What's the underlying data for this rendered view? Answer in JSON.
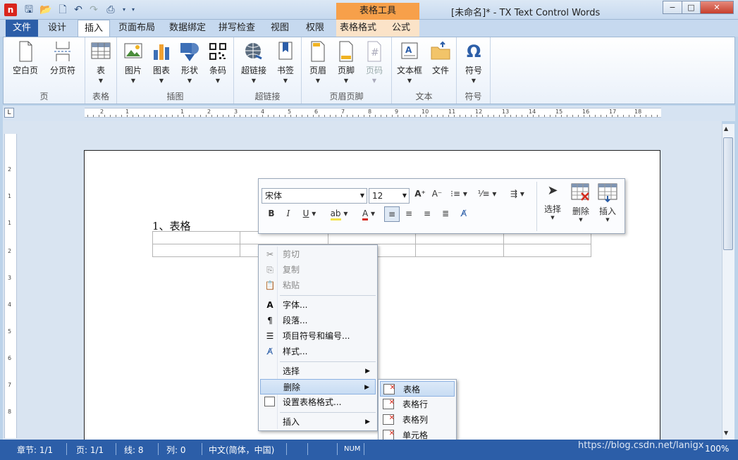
{
  "title_bar": {
    "window_title": "[未命名]* - TX Text Control Words",
    "context_tab_header": "表格工具",
    "minimize": "−",
    "maximize": "□",
    "close": "✕"
  },
  "tabs": [
    "文件",
    "设计",
    "插入",
    "页面布局",
    "数据绑定",
    "拼写检查",
    "视图",
    "权限",
    "表格格式",
    "公式"
  ],
  "ribbon": {
    "groups": {
      "page": {
        "label": "页",
        "buttons": [
          "空白页",
          "分页符"
        ]
      },
      "table": {
        "label": "表格",
        "buttons": [
          "表"
        ]
      },
      "illustrations": {
        "label": "插图",
        "buttons": [
          "图片",
          "图表",
          "形状",
          "条码"
        ]
      },
      "hyperlink": {
        "label": "超链接",
        "buttons": [
          "超链接",
          "书签"
        ]
      },
      "header_footer": {
        "label": "页眉页脚",
        "buttons": [
          "页眉",
          "页脚",
          "页码"
        ]
      },
      "text": {
        "label": "文本",
        "buttons": [
          "文本框",
          "文件"
        ]
      },
      "symbol": {
        "label": "符号",
        "buttons": [
          "符号"
        ]
      }
    }
  },
  "ruler": {
    "h_numbers": [
      "2",
      "1",
      "1",
      "2",
      "3",
      "4",
      "5",
      "6",
      "7",
      "8",
      "9",
      "10",
      "11",
      "12",
      "13",
      "14",
      "15",
      "16",
      "17",
      "18"
    ],
    "v_numbers": [
      "2",
      "1",
      "1",
      "2",
      "3",
      "4",
      "5",
      "6",
      "7",
      "8"
    ]
  },
  "document": {
    "heading": "1、表格",
    "table_rows": 2,
    "table_cols": 5
  },
  "mini_toolbar": {
    "font_name": "宋体",
    "font_size": "12",
    "buttons": {
      "select": "选择",
      "delete": "删除",
      "insert": "插入"
    }
  },
  "context_menu": {
    "items": [
      "剪切",
      "复制",
      "粘贴",
      "字体...",
      "段落...",
      "项目符号和编号...",
      "样式...",
      "选择",
      "删除",
      "设置表格格式...",
      "插入"
    ]
  },
  "submenu_delete": {
    "items": [
      "表格",
      "表格行",
      "表格列",
      "单元格"
    ]
  },
  "status_bar": {
    "section": "章节: 1/1",
    "page": "页: 1/1",
    "line": "线: 8",
    "column": "列: 0",
    "language": "中文(简体，中国)",
    "num": "NUM",
    "zoom": "100%"
  },
  "watermark": "https://blog.csdn.net/lanigx",
  "colors": {
    "accent": "#2c5ea8",
    "context_tab": "#f7a04a",
    "delete_x": "#d62a1c"
  }
}
